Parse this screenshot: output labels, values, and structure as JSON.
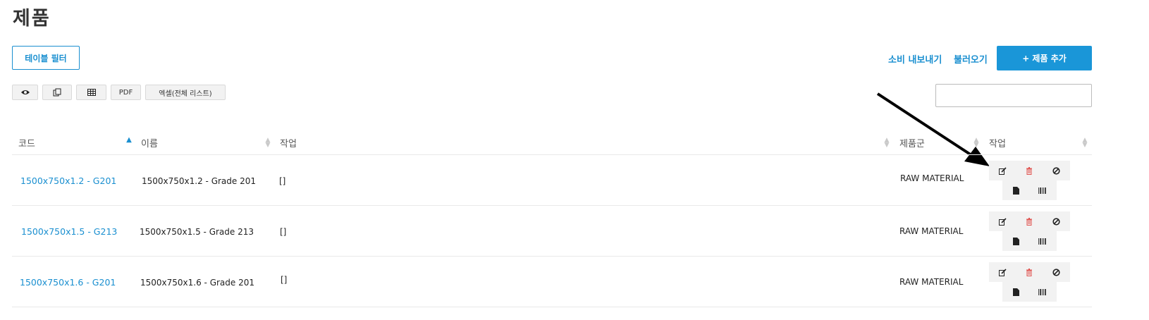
{
  "page": {
    "title": "제품"
  },
  "toolbar": {
    "table_filter_label": "테이블 필터",
    "links": [
      "소비 내보내기",
      "불러오기"
    ],
    "add_product_label": "+ 제품 추가",
    "export_buttons": [
      {
        "icon": "eye-icon",
        "label": ""
      },
      {
        "icon": "copy-icon",
        "label": ""
      },
      {
        "icon": "table-icon",
        "label": ""
      },
      {
        "icon": "",
        "label": "PDF"
      },
      {
        "icon": "",
        "label": "엑셀(전체 리스트)"
      }
    ],
    "search_value": ""
  },
  "table": {
    "columns": [
      "코드",
      "이름",
      "작업",
      "제품군",
      "작업"
    ],
    "rows": [
      {
        "code": "1500x750x1.2 - G201",
        "name": "1500x750x1.2 - Grade 201",
        "task": "[]",
        "group": "RAW MATERIAL"
      },
      {
        "code": "1500x750x1.5 - G213",
        "name": "1500x750x1.5 - Grade 213",
        "task": "[]",
        "group": "RAW MATERIAL"
      },
      {
        "code": "1500x750x1.6 - G201",
        "name": "1500x750x1.6 - Grade 201",
        "task": "[]",
        "group": "RAW MATERIAL"
      }
    ],
    "row_actions": [
      "edit-icon",
      "trash-icon",
      "ban-icon",
      "document-icon",
      "barcode-icon"
    ]
  },
  "colors": {
    "accent": "#1a96d8",
    "link": "#1a8fd0",
    "danger": "#e0524f"
  }
}
